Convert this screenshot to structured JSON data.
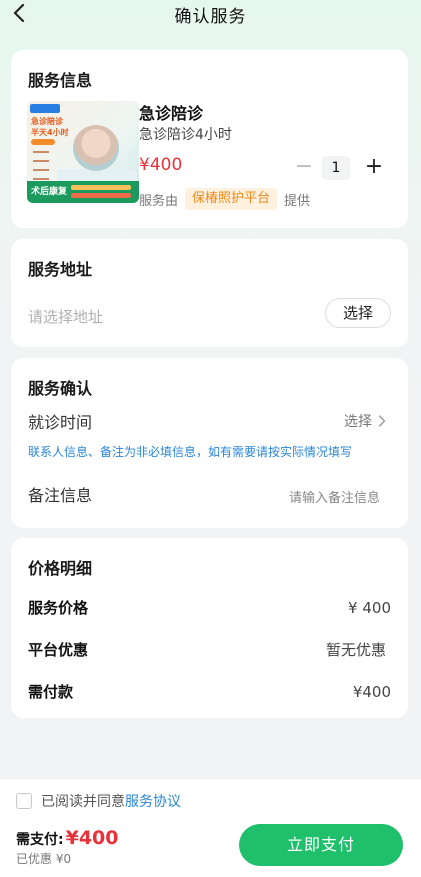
{
  "header": {
    "title": "确认服务"
  },
  "service_card": {
    "section_title": "服务信息",
    "thumbnail": {
      "line1": "急诊陪诊",
      "line2": "半天4小时",
      "footer_text": "术后康复"
    },
    "name": "急诊陪诊",
    "subtitle": "急诊陪诊4小时",
    "price": "¥400",
    "quantity": "1",
    "provider_prefix": "服务由",
    "provider_name": "保椿照护平台",
    "provider_suffix": "提供"
  },
  "address_card": {
    "section_title": "服务地址",
    "placeholder": "请选择地址",
    "select_button": "选择"
  },
  "confirm_card": {
    "section_title": "服务确认",
    "visit_time_label": "就诊时间",
    "visit_time_action": "选择",
    "hint": "联系人信息、备注为非必填信息，如有需要请按实际情况填写",
    "note_label": "备注信息",
    "note_placeholder": "请输入备注信息"
  },
  "price_card": {
    "section_title": "价格明细",
    "rows": [
      {
        "label": "服务价格",
        "value": "¥ 400"
      },
      {
        "label": "平台优惠",
        "value": "暂无优惠"
      },
      {
        "label": "需付款",
        "value": "¥400"
      }
    ]
  },
  "footer": {
    "agree_prefix": "已阅读并同意",
    "agree_link": "服务协议",
    "pay_label": "需支付:",
    "pay_amount": "¥400",
    "discount_text": "已优惠 ¥0",
    "pay_button": "立即支付"
  },
  "colors": {
    "accent_green": "#1fbf6c",
    "price_red": "#e8323a",
    "link_blue": "#2b87d7",
    "badge_orange": "#f08a1c"
  },
  "icons": {
    "back": "chevron-left-icon",
    "arrow": "chevron-right-icon",
    "minus": "minus-icon",
    "plus": "plus-icon"
  }
}
